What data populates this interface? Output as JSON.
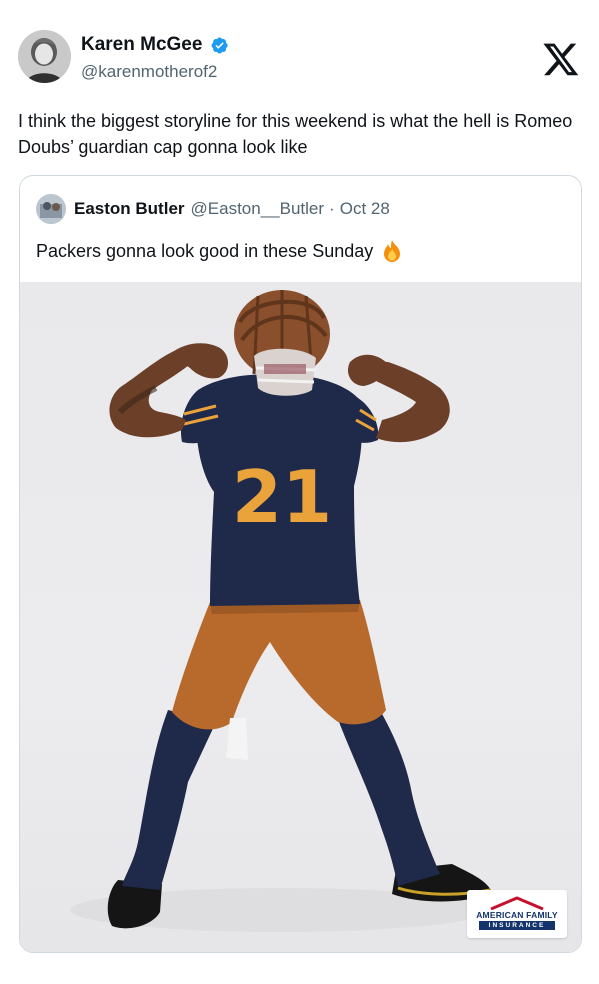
{
  "author": {
    "display_name": "Karen McGee",
    "handle": "@karenmotherof2",
    "verified_icon": "verified-badge-icon",
    "avatar_icon": "author-avatar"
  },
  "platform_logo": "x-logo-icon",
  "tweet": {
    "text": "I think the biggest storyline for this weekend is what the hell is Romeo Doubs’ guardian cap gonna look like"
  },
  "quoted_tweet": {
    "display_name": "Easton Butler",
    "handle": "@Easton__Butler",
    "separator": "·",
    "date": "Oct 28",
    "text": "Packers gonna look good in these Sunday",
    "emoji_icon": "fire-emoji-icon",
    "photo": {
      "jersey_number": "21",
      "sponsor_line1": "AMERICAN FAMILY",
      "sponsor_line2": "INSURANCE"
    }
  },
  "colors": {
    "text_primary": "#0f1419",
    "text_secondary": "#536471",
    "verified_blue": "#1d9bf0",
    "border": "#cfd9de",
    "jersey_navy": "#1f2a4a",
    "pants_orange": "#b86a2c",
    "number_gold": "#e9a33a"
  }
}
